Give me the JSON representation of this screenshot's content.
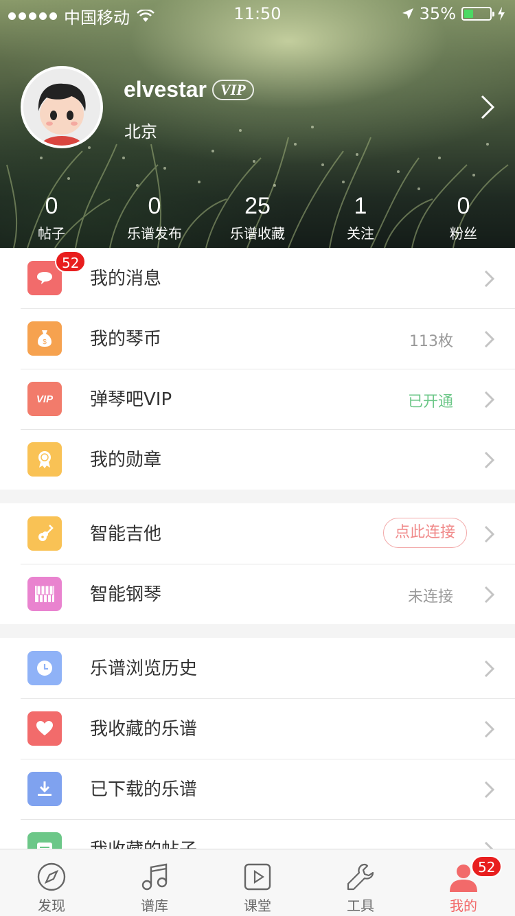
{
  "status_bar": {
    "carrier": "中国移动",
    "time": "11:50",
    "battery_percent": "35%",
    "battery_level": 0.35
  },
  "profile": {
    "username": "elvestar",
    "vip_label": "VIP",
    "city": "北京"
  },
  "stats": [
    {
      "value": "0",
      "label": "帖子"
    },
    {
      "value": "0",
      "label": "乐谱发布"
    },
    {
      "value": "25",
      "label": "乐谱收藏"
    },
    {
      "value": "1",
      "label": "关注"
    },
    {
      "value": "0",
      "label": "粉丝"
    }
  ],
  "section1": {
    "messages_badge": "52",
    "rows": [
      {
        "label": "我的消息",
        "value": "",
        "icon": "chat-bubble-icon",
        "color": "#f26b6b"
      },
      {
        "label": "我的琴币",
        "value": "113枚",
        "icon": "money-bag-icon",
        "color": "#f6a24f"
      },
      {
        "label": "弹琴吧VIP",
        "value": "已开通",
        "icon": "vip-icon",
        "color": "#f27b6b"
      },
      {
        "label": "我的勋章",
        "value": "",
        "icon": "medal-icon",
        "color": "#f9c255"
      }
    ]
  },
  "section2": {
    "rows": [
      {
        "label": "智能吉他",
        "value": "点此连接",
        "icon": "guitar-icon",
        "color": "#f9c255"
      },
      {
        "label": "智能钢琴",
        "value": "未连接",
        "icon": "piano-icon",
        "color": "#e983cf"
      }
    ]
  },
  "section3": {
    "rows": [
      {
        "label": "乐谱浏览历史",
        "value": "",
        "icon": "clock-icon",
        "color": "#8fb2f7"
      },
      {
        "label": "我收藏的乐谱",
        "value": "",
        "icon": "heart-icon",
        "color": "#f26b6b"
      },
      {
        "label": "已下载的乐谱",
        "value": "",
        "icon": "download-icon",
        "color": "#7fa2ef"
      },
      {
        "label": "我收藏的帖子",
        "value": "",
        "icon": "post-icon",
        "color": "#6cc788"
      }
    ]
  },
  "tabbar": {
    "items": [
      {
        "label": "发现",
        "icon": "compass-icon"
      },
      {
        "label": "谱库",
        "icon": "music-note-icon"
      },
      {
        "label": "课堂",
        "icon": "play-icon"
      },
      {
        "label": "工具",
        "icon": "wrench-icon"
      },
      {
        "label": "我的",
        "icon": "user-icon"
      }
    ],
    "active_index": 4,
    "active_color": "#f26a6a",
    "me_badge": "52"
  }
}
